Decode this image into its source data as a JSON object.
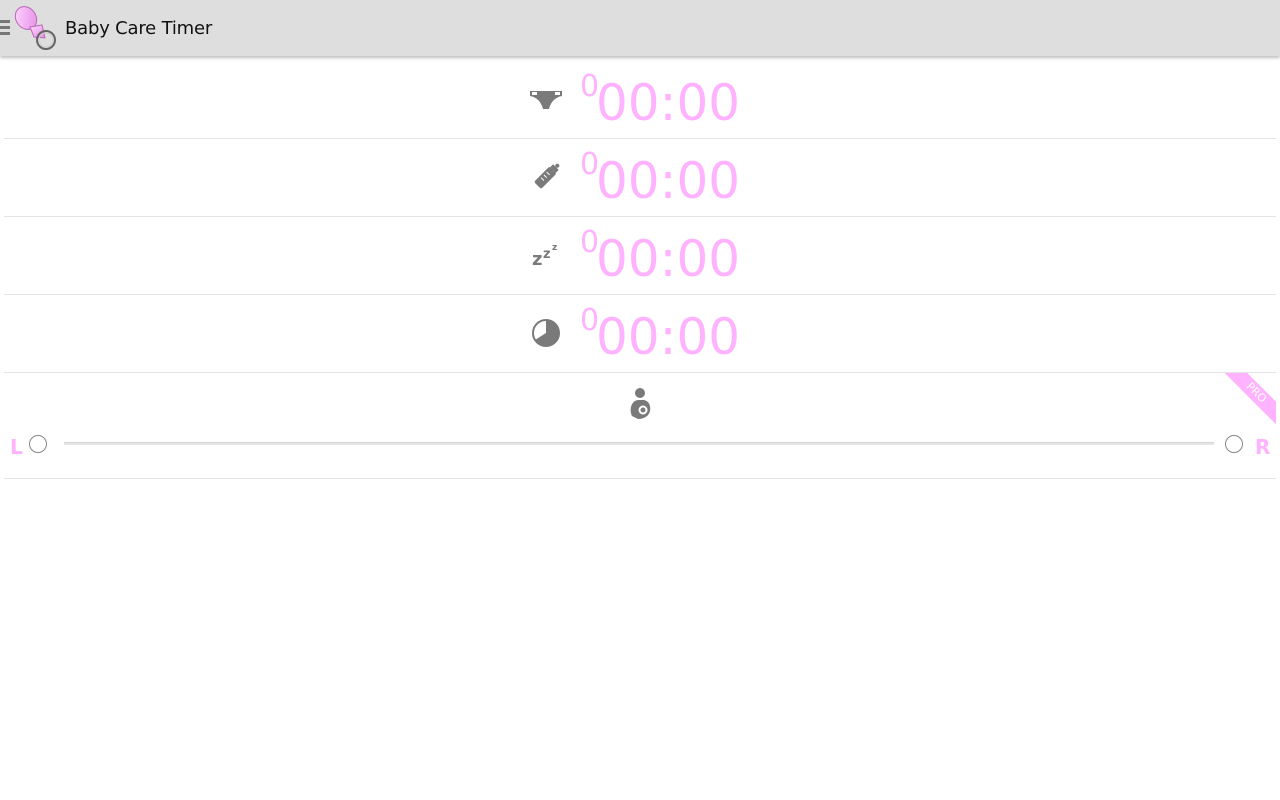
{
  "app": {
    "title": "Baby Care Timer"
  },
  "colors": {
    "accent_pink": "#ffb3ff",
    "icon_gray": "#7a7a7a",
    "actionbar_bg": "#dedede"
  },
  "timers": [
    {
      "name": "diaper",
      "icon": "diaper-icon",
      "count": "0",
      "time": "00:00"
    },
    {
      "name": "bottle",
      "icon": "bottle-icon",
      "count": "0",
      "time": "00:00"
    },
    {
      "name": "sleep",
      "icon": "sleep-icon",
      "count": "0",
      "time": "00:00"
    },
    {
      "name": "clock",
      "icon": "clock-icon",
      "count": "0",
      "time": "00:00"
    }
  ],
  "nursing": {
    "icon": "nursing-icon",
    "left_label": "L",
    "right_label": "R",
    "badge": "PRO"
  }
}
